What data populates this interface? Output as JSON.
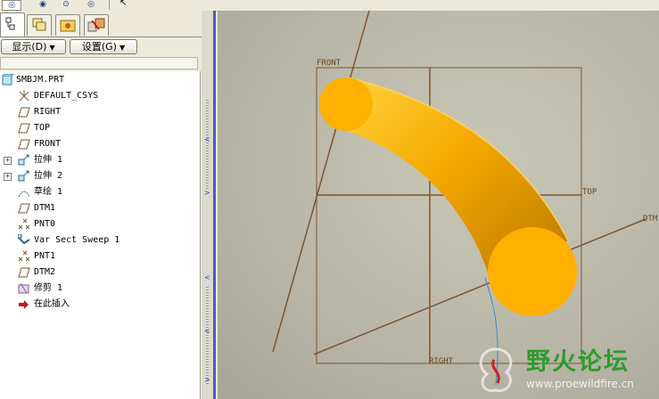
{
  "toolbar": {
    "buttons": [
      {
        "name": "view-eye-1-button",
        "glyph": "◎"
      },
      {
        "name": "view-eye-2-button",
        "glyph": "◉"
      },
      {
        "name": "view-eye-3-button",
        "glyph": "⊙"
      },
      {
        "name": "view-eye-4-button",
        "glyph": "◎"
      }
    ]
  },
  "panel": {
    "display_label": "显示",
    "display_key": "(D)",
    "settings_label": "设置",
    "settings_key": "(G)"
  },
  "tree": {
    "items": [
      {
        "label": "SMBJM.PRT",
        "icon": "part-icon",
        "expandable": false
      },
      {
        "label": "DEFAULT_CSYS",
        "icon": "csys-icon",
        "expandable": false
      },
      {
        "label": "RIGHT",
        "icon": "datum-plane-icon",
        "expandable": false
      },
      {
        "label": "TOP",
        "icon": "datum-plane-icon",
        "expandable": false
      },
      {
        "label": "FRONT",
        "icon": "datum-plane-icon",
        "expandable": false
      },
      {
        "label": "拉伸 1",
        "icon": "extrude-icon",
        "expandable": true
      },
      {
        "label": "拉伸 2",
        "icon": "extrude-icon",
        "expandable": true
      },
      {
        "label": "草绘 1",
        "icon": "sketch-icon",
        "expandable": false
      },
      {
        "label": "DTM1",
        "icon": "datum-plane-icon",
        "expandable": false
      },
      {
        "label": "PNT0",
        "icon": "datum-point-icon",
        "expandable": false
      },
      {
        "label": "Var Sect Sweep 1",
        "icon": "sweep-icon",
        "expandable": false
      },
      {
        "label": "PNT1",
        "icon": "datum-point-icon",
        "expandable": false
      },
      {
        "label": "DTM2",
        "icon": "datum-plane-icon",
        "expandable": false
      },
      {
        "label": "修剪 1",
        "icon": "trim-icon",
        "expandable": false
      },
      {
        "label": "在此插入",
        "icon": "insert-arrow-icon",
        "expandable": false
      }
    ]
  },
  "viewport": {
    "plane_labels": {
      "front": "FRONT",
      "top": "TOP",
      "right": "RIGHT",
      "dtm": "DTM"
    }
  },
  "watermark": {
    "title": "野火论坛",
    "url": "www.proewildfire.cn"
  },
  "colors": {
    "sweep": "#f5a800",
    "sweep_end": "#ffb000",
    "datum_plane": "#7a5532",
    "panel_bg": "#ece9d8",
    "watermark_green": "#2e9b2e"
  }
}
